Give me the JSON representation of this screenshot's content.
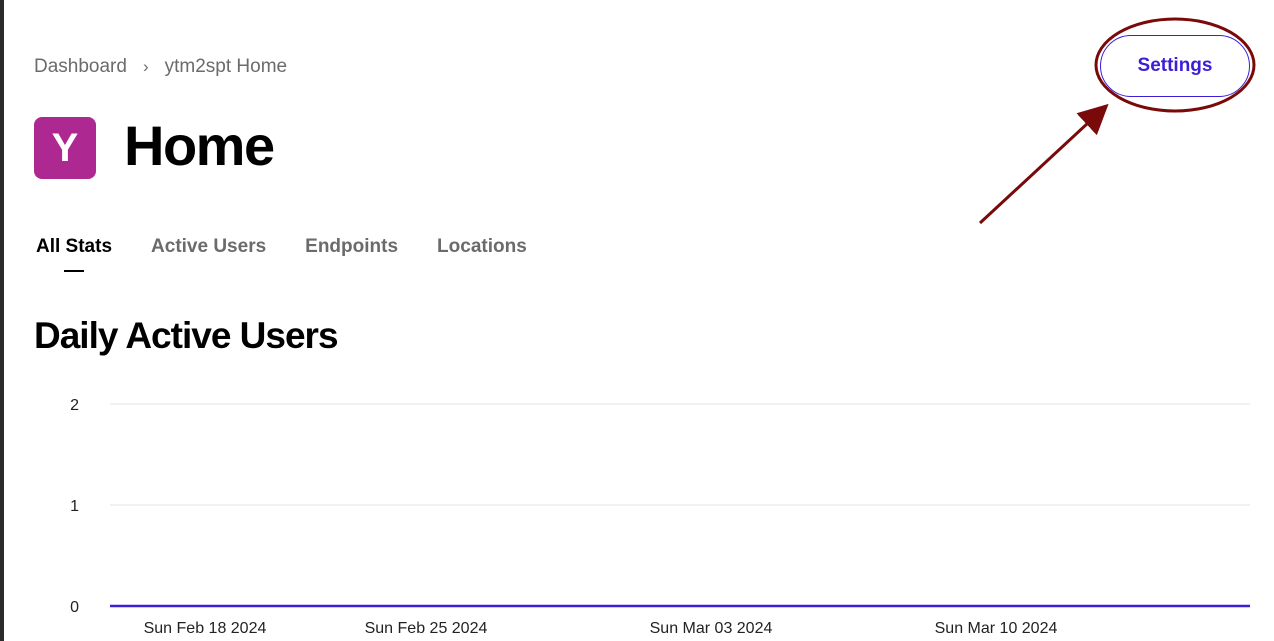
{
  "breadcrumb": {
    "items": [
      "Dashboard",
      "ytm2spt Home"
    ],
    "separator": "›"
  },
  "header": {
    "settings_label": "Settings"
  },
  "app": {
    "avatar_letter": "Y",
    "avatar_color": "#ad2891",
    "title": "Home"
  },
  "tabs": [
    {
      "label": "All Stats",
      "active": true
    },
    {
      "label": "Active Users",
      "active": false
    },
    {
      "label": "Endpoints",
      "active": false
    },
    {
      "label": "Locations",
      "active": false
    }
  ],
  "section": {
    "title": "Daily Active Users"
  },
  "colors": {
    "accent": "#3a1fd6",
    "annotation": "#7a0a0a",
    "line": "#3a1fd6"
  },
  "chart_data": {
    "type": "line",
    "title": "Daily Active Users",
    "xlabel": "",
    "ylabel": "",
    "ylim": [
      0,
      2
    ],
    "yticks": [
      "0",
      "1",
      "2"
    ],
    "xticks": [
      "Sun Feb 18 2024",
      "Sun Feb 25 2024",
      "Sun Mar 03 2024",
      "Sun Mar 10 2024"
    ],
    "grid": true,
    "series": [
      {
        "values": [
          0,
          0,
          0,
          0,
          0
        ]
      }
    ]
  }
}
